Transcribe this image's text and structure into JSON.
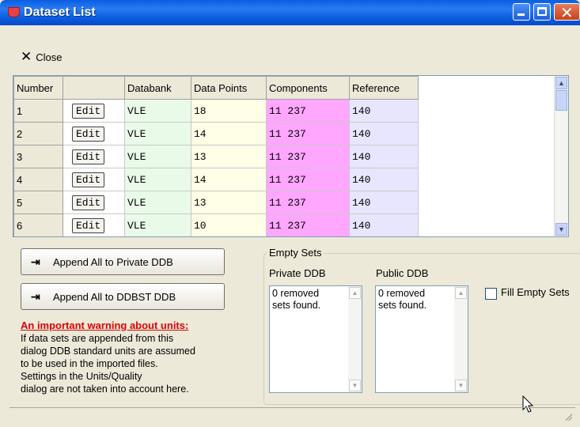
{
  "window": {
    "title": "Dataset List"
  },
  "toolbar": {
    "close_label": "Close"
  },
  "grid": {
    "headers": [
      "Number",
      "",
      "Databank",
      "Data Points",
      "Components",
      "Reference"
    ],
    "rows": [
      {
        "number": "1",
        "edit": "Edit",
        "databank": "VLE",
        "points": "18",
        "components": "11 237",
        "reference": "140"
      },
      {
        "number": "2",
        "edit": "Edit",
        "databank": "VLE",
        "points": "14",
        "components": "11 237",
        "reference": "140"
      },
      {
        "number": "3",
        "edit": "Edit",
        "databank": "VLE",
        "points": "13",
        "components": "11 237",
        "reference": "140"
      },
      {
        "number": "4",
        "edit": "Edit",
        "databank": "VLE",
        "points": "14",
        "components": "11 237",
        "reference": "140"
      },
      {
        "number": "5",
        "edit": "Edit",
        "databank": "VLE",
        "points": "13",
        "components": "11 237",
        "reference": "140"
      },
      {
        "number": "6",
        "edit": "Edit",
        "databank": "VLE",
        "points": "10",
        "components": "11 237",
        "reference": "140"
      }
    ]
  },
  "buttons": {
    "append_private": "Append All to Private DDB",
    "append_ddbst": "Append All to DDBST DDB"
  },
  "warning": {
    "title": "An important warning about units:",
    "lines": [
      "If data sets are appended from this",
      "dialog DDB standard units are assumed",
      "to be used in the imported files.",
      "Settings in the Units/Quality",
      "dialog are not taken into account here."
    ]
  },
  "empty_sets": {
    "group_label": "Empty Sets",
    "private_label": "Private DDB",
    "public_label": "Public DDB",
    "private_text_1": "0 removed",
    "private_text_2": "sets found.",
    "public_text_1": "0 removed",
    "public_text_2": "sets found.",
    "fill_label": "Fill Empty Sets",
    "fill_checked": false
  }
}
